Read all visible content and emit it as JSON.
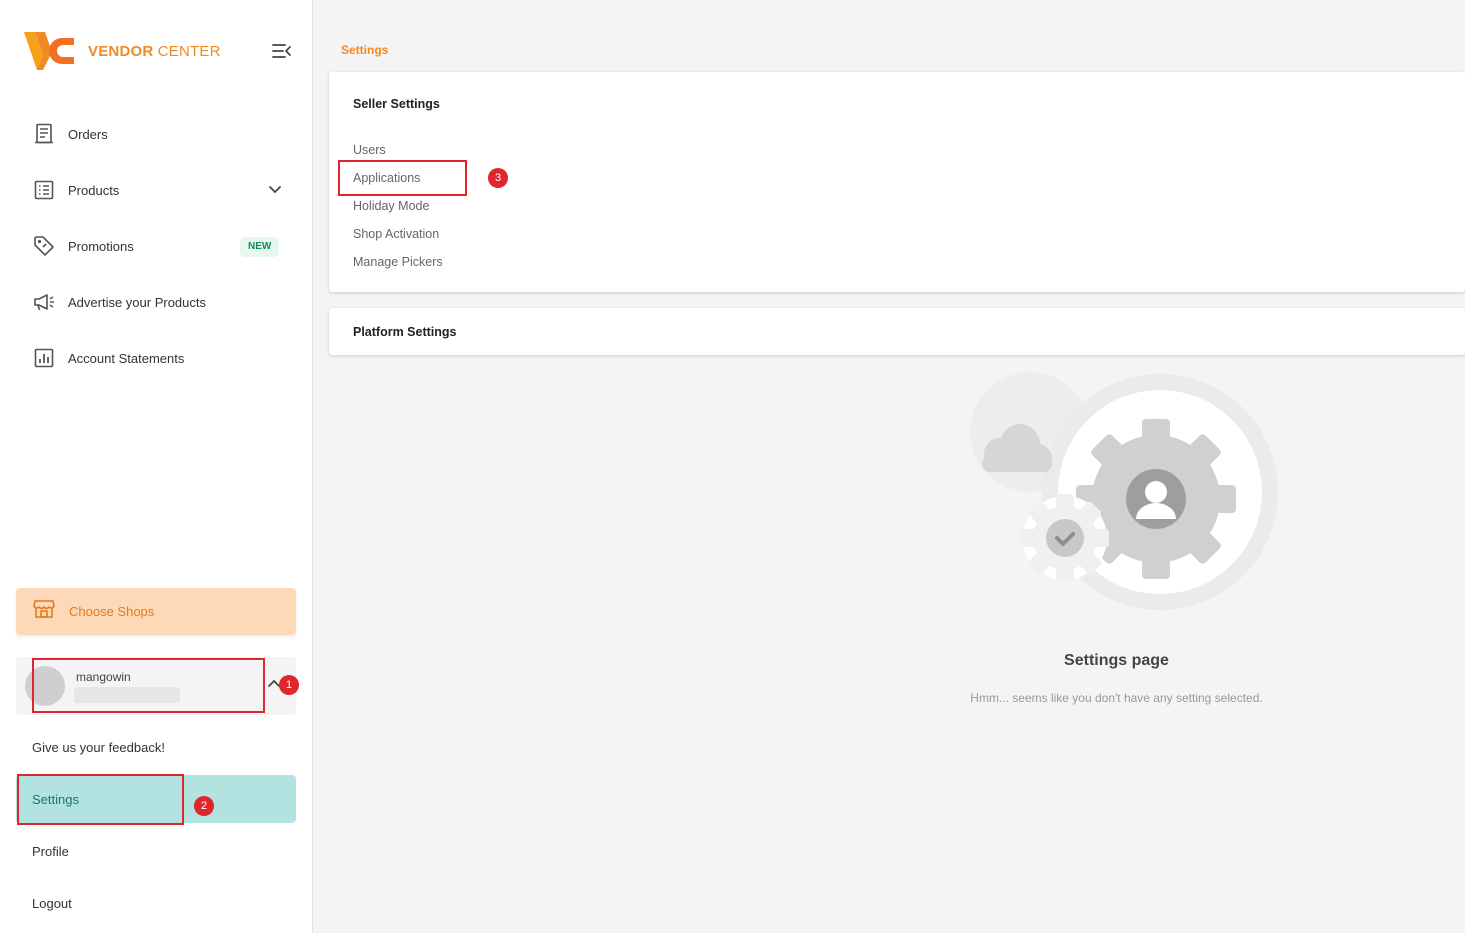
{
  "brand": {
    "name_bold": "VENDOR",
    "name_rest": " CENTER",
    "color": "#f08a24"
  },
  "sidebar": {
    "items": [
      {
        "label": "Orders",
        "icon": "receipt-icon"
      },
      {
        "label": "Products",
        "icon": "list-icon",
        "has_chevron": true
      },
      {
        "label": "Promotions",
        "icon": "tag-icon",
        "badge": "NEW"
      },
      {
        "label": "Advertise your Products",
        "icon": "megaphone-icon"
      },
      {
        "label": "Account Statements",
        "icon": "bar-chart-icon"
      }
    ],
    "choose_shops": "Choose Shops",
    "account": {
      "name": "mangowin"
    },
    "feedback": "Give us your feedback!",
    "settings": "Settings",
    "profile": "Profile",
    "logout": "Logout"
  },
  "main": {
    "breadcrumb": "Settings",
    "seller_settings": {
      "title": "Seller Settings",
      "links": [
        "Users",
        "Applications",
        "Holiday Mode",
        "Shop Activation",
        "Manage Pickers"
      ]
    },
    "platform_settings": {
      "title": "Platform Settings"
    },
    "empty_state": {
      "title": "Settings page",
      "subtitle": "Hmm... seems like you don't have any setting selected."
    }
  },
  "annotations": {
    "step1": "1",
    "step2": "2",
    "step3": "3",
    "color": "#e0262d"
  }
}
